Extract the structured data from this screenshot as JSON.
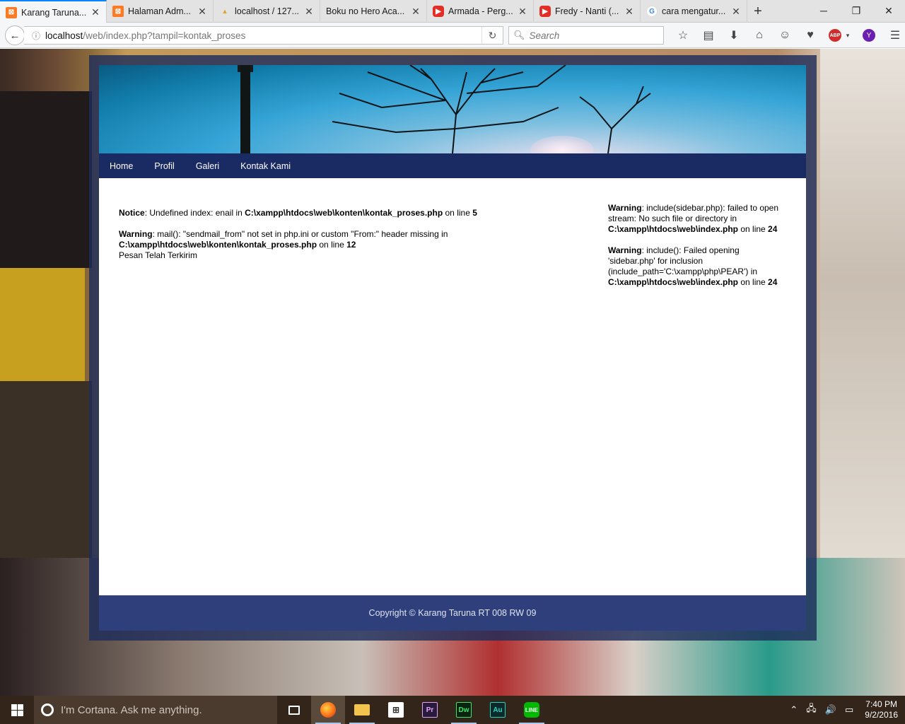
{
  "browser": {
    "tabs": [
      {
        "title": "Karang Taruna...",
        "favicon": "xampp-icon",
        "active": true
      },
      {
        "title": "Halaman Adm...",
        "favicon": "xampp-icon",
        "active": false
      },
      {
        "title": "localhost / 127...",
        "favicon": "phpmyadmin-icon",
        "active": false
      },
      {
        "title": "Boku no Hero Aca...",
        "favicon": "",
        "active": false
      },
      {
        "title": "Armada - Perg...",
        "favicon": "youtube-icon",
        "active": false
      },
      {
        "title": "Fredy - Nanti (...",
        "favicon": "youtube-icon",
        "active": false
      },
      {
        "title": "cara mengatur...",
        "favicon": "google-icon",
        "active": false
      }
    ],
    "url_host": "localhost",
    "url_path": "/web/index.php?tampil=kontak_proses",
    "search_placeholder": "Search",
    "abp_label": "ABP",
    "profile_initial": "Y"
  },
  "site": {
    "menu": [
      "Home",
      "Profil",
      "Galeri",
      "Kontak Kami"
    ],
    "main_messages": [
      {
        "level": "Notice",
        "text": ": Undefined index: enail in ",
        "file": "C:\\xampp\\htdocs\\web\\konten\\kontak_proses.php",
        "on_line": " on line ",
        "line": "5"
      },
      {
        "level": "Warning",
        "text": ": mail(): \"sendmail_from\" not set in php.ini or custom \"From:\" header missing in ",
        "file": "C:\\xampp\\htdocs\\web\\konten\\kontak_proses.php",
        "on_line": " on line ",
        "line": "12"
      }
    ],
    "success_text": "Pesan Telah Terkirim",
    "side_messages": [
      {
        "level": "Warning",
        "text": ": include(sidebar.php): failed to open stream: No such file or directory in ",
        "file": "C:\\xampp\\htdocs\\web\\index.php",
        "on_line": " on line ",
        "line": "24"
      },
      {
        "level": "Warning",
        "text": ": include(): Failed opening 'sidebar.php' for inclusion (include_path='C:\\xampp\\php\\PEAR') in ",
        "file": "C:\\xampp\\htdocs\\web\\index.php",
        "on_line": " on line ",
        "line": "24"
      }
    ],
    "footer": "Copyright © Karang Taruna RT 008 RW 09"
  },
  "taskbar": {
    "cortana_placeholder": "I'm Cortana. Ask me anything.",
    "apps": [
      "task-view-icon",
      "firefox-icon",
      "file-explorer-icon",
      "store-icon",
      "premiere-icon",
      "dreamweaver-icon",
      "audition-icon",
      "line-icon"
    ],
    "app_labels": {
      "premiere": "Pr",
      "dreamweaver": "Dw",
      "audition": "Au",
      "line": "LINE"
    },
    "time": "7:40 PM",
    "date": "9/2/2016"
  }
}
